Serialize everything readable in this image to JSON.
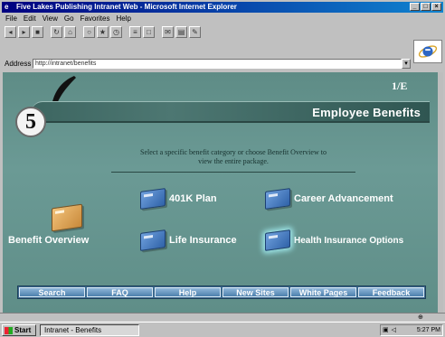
{
  "window": {
    "title": "Five Lakes Publishing Intranet Web - Microsoft Internet Explorer",
    "controls": [
      "_",
      "□",
      "×"
    ]
  },
  "menu": [
    "File",
    "Edit",
    "View",
    "Go",
    "Favorites",
    "Help"
  ],
  "toolbar_icons": [
    "back-icon",
    "forward-icon",
    "stop-icon",
    "refresh-icon",
    "home-icon",
    "search-icon",
    "favorites-icon",
    "history-icon",
    "channels-icon",
    "fullscreen-icon",
    "mail-icon",
    "print-icon",
    "edit-icon"
  ],
  "address": {
    "label": "Address",
    "value": "http://intranet/benefits",
    "dropdown": "▾"
  },
  "page": {
    "chapter_number": "5",
    "page_code": "1/E",
    "banner_title": "Employee Benefits",
    "instructions": "Select a specific benefit category or choose Benefit Overview to view the entire package.",
    "benefits": {
      "overview": "Benefit Overview",
      "k401": "401K Plan",
      "career": "Career Advancement",
      "life": "Life Insurance",
      "health": "Health Insurance Options"
    },
    "nav": [
      "Search",
      "FAQ",
      "Help",
      "New Sites",
      "White Pages",
      "Feedback"
    ]
  },
  "status": {
    "zone_icon": "⊕"
  },
  "taskbar": {
    "start": "Start",
    "task": "Intranet - Benefits",
    "clock": "5:27 PM",
    "tray_icons": [
      "network-icon",
      "volume-icon"
    ]
  },
  "colors": {
    "title_bar": "#000080",
    "page_background": "#5e8c86",
    "banner": "#3d6661",
    "nav_button": "#4c80ad"
  }
}
